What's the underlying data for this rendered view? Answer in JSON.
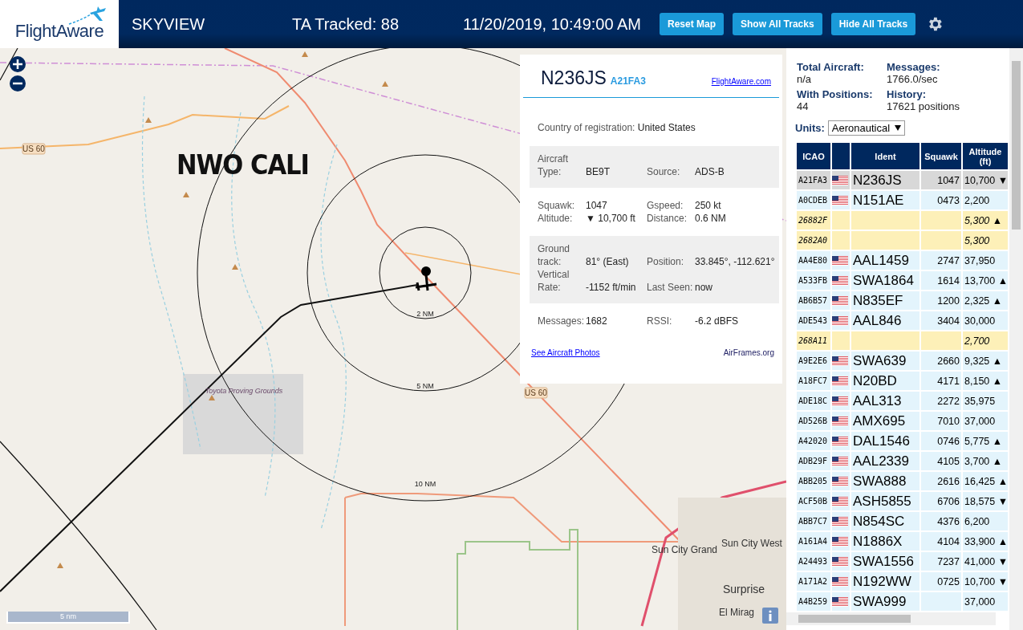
{
  "header": {
    "logo": "FlightAware",
    "title": "SKYVIEW",
    "tracked": "TA Tracked: 88",
    "datetime": "11/20/2019, 10:49:00 AM",
    "buttons": [
      "Reset Map",
      "Show All Tracks",
      "Hide All Tracks"
    ]
  },
  "map": {
    "overlay_label": "NWO CALI",
    "rings": [
      "2 NM",
      "5 NM",
      "10 NM"
    ],
    "scale": "5 nm",
    "labels": [
      {
        "kind": "shield",
        "text": "US 60"
      },
      {
        "kind": "area",
        "text": "Toyota Proving Grounds"
      },
      {
        "kind": "shield",
        "text": "US 60"
      },
      {
        "kind": "town",
        "text": "Sun City Grand"
      },
      {
        "kind": "town",
        "text": "Sun City West"
      },
      {
        "kind": "city",
        "text": "Surprise"
      },
      {
        "kind": "town",
        "text": "El Mirag"
      }
    ]
  },
  "popup": {
    "ident": "N236JS",
    "icao": "A21FA3",
    "link": "FlightAware.com",
    "country": {
      "label": "Country of registration:",
      "value": "United States"
    },
    "sections": [
      {
        "shaded": true,
        "rows": [
          [
            "Aircraft Type:",
            "BE9T",
            "Source:",
            "ADS-B"
          ]
        ]
      },
      {
        "shaded": false,
        "rows": [
          [
            "Squawk:",
            "1047",
            "Gspeed:",
            "250 kt"
          ],
          [
            "Altitude:",
            "▼ 10,700 ft",
            "Distance:",
            "0.6 NM"
          ]
        ]
      },
      {
        "shaded": true,
        "rows": [
          [
            "Ground track:",
            "81° (East)",
            "Position:",
            "33.845°, -112.621°"
          ],
          [
            "Vertical Rate:",
            "-1152 ft/min",
            "Last Seen:",
            "now"
          ]
        ]
      },
      {
        "shaded": false,
        "rows": [
          [
            "Messages:",
            "1682",
            "RSSI:",
            "-6.2 dBFS"
          ]
        ]
      }
    ],
    "footer_links": [
      "See Aircraft Photos",
      "AirFrames.org"
    ]
  },
  "stats": [
    {
      "label": "Total Aircraft:",
      "value": "n/a"
    },
    {
      "label": "Messages:",
      "value": "1766.0/sec"
    },
    {
      "label": "With Positions:",
      "value": "44"
    },
    {
      "label": "History:",
      "value": "17621 positions"
    }
  ],
  "units": {
    "label": "Units:",
    "value": "Aeronautical"
  },
  "table": {
    "columns": [
      "ICAO",
      "Ident",
      "Squawk",
      "Altitude (ft)"
    ],
    "rows": [
      {
        "kind": "adsb",
        "selected": true,
        "icao": "A21FA3",
        "ident": "N236JS",
        "squawk": "1047",
        "altitude": "10,700 ▼"
      },
      {
        "kind": "adsb",
        "selected": false,
        "icao": "A0CDEB",
        "ident": "N151AE",
        "squawk": "0473",
        "altitude": "2,200"
      },
      {
        "kind": "noposition",
        "selected": false,
        "icao": "26882F",
        "ident": "",
        "squawk": "",
        "altitude": "5,300 ▲"
      },
      {
        "kind": "noposition",
        "selected": false,
        "icao": "2682A0",
        "ident": "",
        "squawk": "",
        "altitude": "5,300"
      },
      {
        "kind": "adsb",
        "selected": false,
        "icao": "AA4E80",
        "ident": "AAL1459",
        "squawk": "2747",
        "altitude": "37,950"
      },
      {
        "kind": "adsb",
        "selected": false,
        "icao": "A533FB",
        "ident": "SWA1864",
        "squawk": "1614",
        "altitude": "13,700 ▲"
      },
      {
        "kind": "adsb",
        "selected": false,
        "icao": "AB6B57",
        "ident": "N835EF",
        "squawk": "1200",
        "altitude": "2,325 ▲"
      },
      {
        "kind": "adsb",
        "selected": false,
        "icao": "ADE543",
        "ident": "AAL846",
        "squawk": "3404",
        "altitude": "30,000"
      },
      {
        "kind": "noposition",
        "selected": false,
        "icao": "268A11",
        "ident": "",
        "squawk": "",
        "altitude": "2,700"
      },
      {
        "kind": "adsb",
        "selected": false,
        "icao": "A9E2E6",
        "ident": "SWA639",
        "squawk": "2660",
        "altitude": "9,325 ▲"
      },
      {
        "kind": "adsb",
        "selected": false,
        "icao": "A18FC7",
        "ident": "N20BD",
        "squawk": "4171",
        "altitude": "8,150 ▲"
      },
      {
        "kind": "adsb",
        "selected": false,
        "icao": "ADE18C",
        "ident": "AAL313",
        "squawk": "2272",
        "altitude": "35,975"
      },
      {
        "kind": "adsb",
        "selected": false,
        "icao": "AD526B",
        "ident": "AMX695",
        "squawk": "7010",
        "altitude": "37,000"
      },
      {
        "kind": "adsb",
        "selected": false,
        "icao": "A42020",
        "ident": "DAL1546",
        "squawk": "0746",
        "altitude": "5,775 ▲"
      },
      {
        "kind": "adsb",
        "selected": false,
        "icao": "ADB29F",
        "ident": "AAL2339",
        "squawk": "4105",
        "altitude": "3,700 ▲"
      },
      {
        "kind": "adsb",
        "selected": false,
        "icao": "ABB205",
        "ident": "SWA888",
        "squawk": "2616",
        "altitude": "16,425 ▲"
      },
      {
        "kind": "adsb",
        "selected": false,
        "icao": "ACF50B",
        "ident": "ASH5855",
        "squawk": "6706",
        "altitude": "18,575 ▼"
      },
      {
        "kind": "adsb",
        "selected": false,
        "icao": "ABB7C7",
        "ident": "N854SC",
        "squawk": "4376",
        "altitude": "6,200"
      },
      {
        "kind": "adsb",
        "selected": false,
        "icao": "A161A4",
        "ident": "N1886X",
        "squawk": "4104",
        "altitude": "33,900 ▲"
      },
      {
        "kind": "adsb",
        "selected": false,
        "icao": "A24493",
        "ident": "SWA1556",
        "squawk": "7237",
        "altitude": "41,000 ▼"
      },
      {
        "kind": "adsb",
        "selected": false,
        "icao": "A171A2",
        "ident": "N192WW",
        "squawk": "0725",
        "altitude": "10,700 ▼"
      },
      {
        "kind": "adsb",
        "selected": false,
        "icao": "A4B259",
        "ident": "SWA999",
        "squawk": "",
        "altitude": "37,000"
      }
    ]
  }
}
